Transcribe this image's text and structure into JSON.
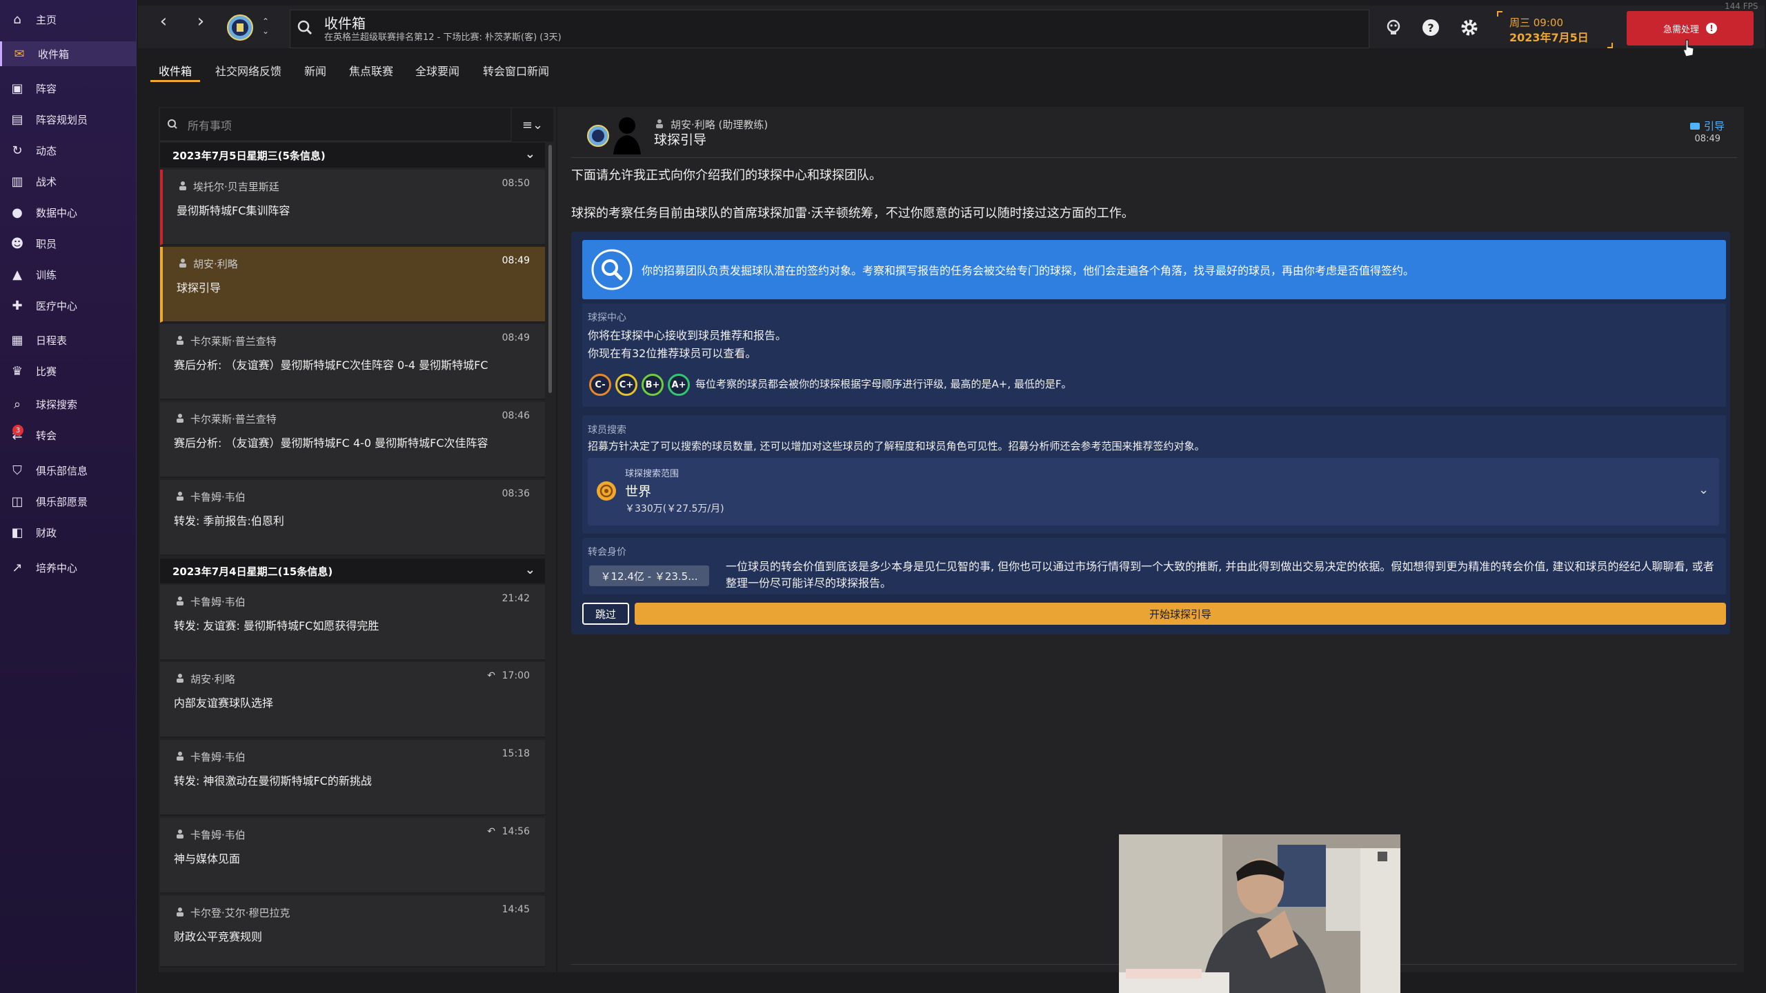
{
  "sidebar": {
    "items": [
      {
        "label": "主页",
        "icon": "home-icon"
      },
      {
        "label": "收件箱",
        "icon": "inbox-icon",
        "active": true
      },
      {
        "label": "阵容",
        "icon": "shirt-icon"
      },
      {
        "label": "阵容规划员",
        "icon": "clipboard-icon"
      },
      {
        "label": "动态",
        "icon": "dynamics-icon"
      },
      {
        "label": "战术",
        "icon": "tactics-icon"
      },
      {
        "label": "数据中心",
        "icon": "data-hub-icon"
      },
      {
        "label": "职员",
        "icon": "staff-icon"
      },
      {
        "label": "训练",
        "icon": "training-icon"
      },
      {
        "label": "医疗中心",
        "icon": "medical-icon"
      },
      {
        "label": "日程表",
        "icon": "calendar-icon"
      },
      {
        "label": "比赛",
        "icon": "trophy-icon"
      },
      {
        "label": "球探搜索",
        "icon": "scouting-icon"
      },
      {
        "label": "转会",
        "icon": "transfers-icon",
        "badge": "3"
      },
      {
        "label": "俱乐部信息",
        "icon": "shield-icon"
      },
      {
        "label": "俱乐部愿景",
        "icon": "vision-icon"
      },
      {
        "label": "财政",
        "icon": "finance-icon"
      },
      {
        "label": "培养中心",
        "icon": "development-icon"
      }
    ]
  },
  "header": {
    "title": "收件箱",
    "subtitle": "在英格兰超级联赛排名第12 - 下场比赛: 朴茨茅斯(客) (3天)",
    "day_time": "周三 09:00",
    "date": "2023年7月5日",
    "urgent_label": "急需处理",
    "fps": "144 FPS"
  },
  "tabs": [
    "收件箱",
    "社交网络反馈",
    "新闻",
    "焦点联赛",
    "全球要闻",
    "转会窗口新闻"
  ],
  "inbox": {
    "filter_placeholder": "所有事项",
    "groups": [
      {
        "header": "2023年7月5日星期三(5条信息)",
        "messages": [
          {
            "sender": "埃托尔·贝吉里斯廷",
            "time": "08:50",
            "subject": "曼彻斯特城FC集训阵容",
            "state": "unread"
          },
          {
            "sender": "胡安·利略",
            "time": "08:49",
            "subject": "球探引导",
            "state": "selected"
          },
          {
            "sender": "卡尔莱斯·普兰查特",
            "time": "08:49",
            "subject": "赛后分析: （友谊赛）曼彻斯特城FC次佳阵容 0-4 曼彻斯特城FC",
            "state": "read"
          },
          {
            "sender": "卡尔莱斯·普兰查特",
            "time": "08:46",
            "subject": "赛后分析: （友谊赛）曼彻斯特城FC 4-0 曼彻斯特城FC次佳阵容",
            "state": "read"
          },
          {
            "sender": "卡鲁姆·韦伯",
            "time": "08:36",
            "subject": "转发: 季前报告:伯恩利",
            "state": "read"
          }
        ]
      },
      {
        "header": "2023年7月4日星期二(15条信息)",
        "messages": [
          {
            "sender": "卡鲁姆·韦伯",
            "time": "21:42",
            "subject": "转发: 友谊赛: 曼彻斯特城FC如愿获得完胜",
            "state": "read"
          },
          {
            "sender": "胡安·利略",
            "time": "17:00",
            "subject": "内部友谊赛球队选择",
            "state": "read",
            "replied": true
          },
          {
            "sender": "卡鲁姆·韦伯",
            "time": "15:18",
            "subject": "转发: 神很激动在曼彻斯特城FC的新挑战",
            "state": "read"
          },
          {
            "sender": "卡鲁姆·韦伯",
            "time": "14:56",
            "subject": "神与媒体见面",
            "state": "read",
            "replied": true
          },
          {
            "sender": "卡尔登·艾尔·穆巴拉克",
            "time": "14:45",
            "subject": "财政公平竞赛规则",
            "state": "read"
          }
        ]
      }
    ]
  },
  "detail": {
    "sender": "胡安·利略 (助理教练)",
    "subject": "球探引导",
    "tag": "引导",
    "time": "08:49",
    "paragraph1": "下面请允许我正式向你介绍我们的球探中心和球探团队。",
    "paragraph2": "球探的考察任务目前由球队的首席球探加雷·沃辛顿统筹，不过你愿意的话可以随时接过这方面的工作。",
    "banner": "你的招募团队负责发掘球队潜在的签约对象。考察和撰写报告的任务会被交给专门的球探，他们会走遍各个角落，找寻最好的球员，再由你考虑是否值得签约。",
    "scout_center": {
      "title": "球探中心",
      "line1": "你将在球探中心接收到球员推荐和报告。",
      "line2": "你现在有32位推荐球员可以查看。",
      "grades": [
        {
          "label": "C-",
          "color": "#e58a2a"
        },
        {
          "label": "C+",
          "color": "#e2c32a"
        },
        {
          "label": "B+",
          "color": "#6fcf3a"
        },
        {
          "label": "A+",
          "color": "#2fc86a"
        }
      ],
      "grade_text": "每位考察的球员都会被你的球探根据字母顺序进行评级, 最高的是A+, 最低的是F。"
    },
    "player_search": {
      "title": "球员搜索",
      "text": "招募方针决定了可以搜索的球员数量, 还可以增加对这些球员的了解程度和球员角色可见性。招募分析师还会参考范围来推荐签约对象。",
      "range_label": "球探搜索范围",
      "range_value": "世界",
      "range_cost": "￥330万(￥27.5万/月)"
    },
    "transfer_value": {
      "title": "转会身价",
      "pill": "￥12.4亿 - ￥23.5...",
      "text": "一位球员的转会价值到底该是多少本身是见仁见智的事, 但你也可以通过市场行情得到一个大致的推断, 并由此得到做出交易决定的依据。假如想得到更为精准的转会价值, 建议和球员的经纪人聊聊看, 或者整理一份尽可能详尽的球探报告。"
    },
    "skip_label": "跳过",
    "start_label": "开始球探引导"
  },
  "colors": {
    "accent": "#f0a830",
    "urgent": "#c8252f",
    "banner": "#2e7fe0",
    "card": "#1e2a4a"
  }
}
